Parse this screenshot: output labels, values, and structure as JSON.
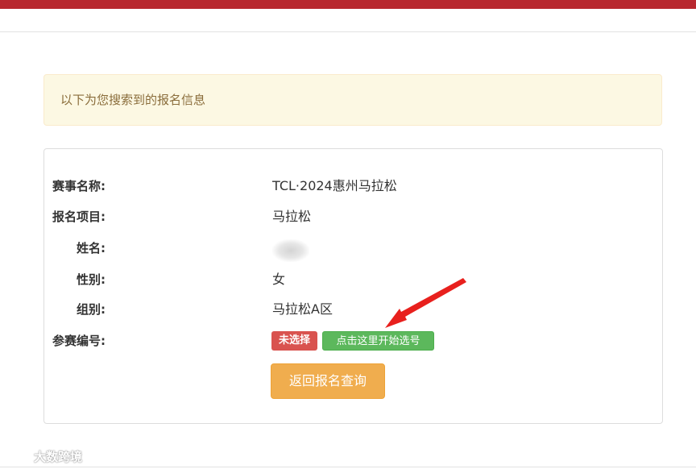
{
  "alert": {
    "text": "以下为您搜索到的报名信息"
  },
  "registration": {
    "rows": [
      {
        "label": "赛事名称:",
        "value": "TCL·2024惠州马拉松"
      },
      {
        "label": "报名项目:",
        "value": "马拉松"
      },
      {
        "label": "姓名:",
        "value": ""
      },
      {
        "label": "性别:",
        "value": "女"
      },
      {
        "label": "组别:",
        "value": "马拉松A区"
      },
      {
        "label": "参赛编号:",
        "value": ""
      }
    ],
    "bib_status_badge": "未选择",
    "choose_bib_button": "点击这里开始选号",
    "back_button": "返回报名查询"
  },
  "watermark": {
    "text": "大数跨境"
  },
  "colors": {
    "top_bar": "#b8282f",
    "alert_bg": "#fcf8e3",
    "alert_text": "#8a6d3b",
    "danger": "#d9534f",
    "success": "#5cb85c",
    "warning": "#f0ad4e",
    "annotation_arrow": "#e8201d"
  }
}
